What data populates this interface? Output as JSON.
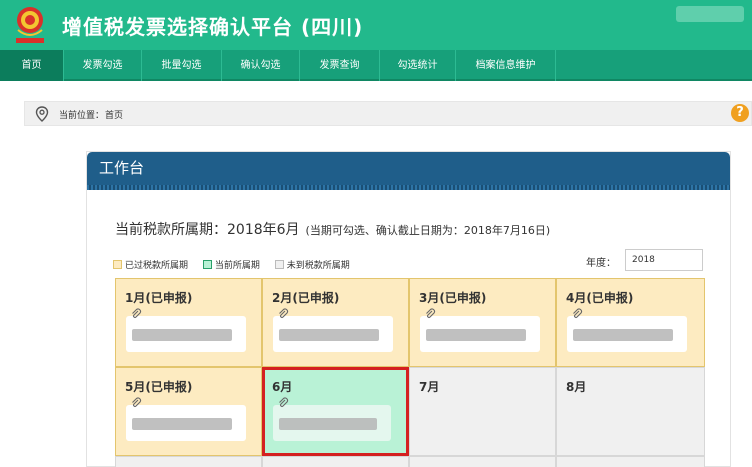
{
  "header": {
    "title": "增值税发票选择确认平台 (四川)",
    "logo": "national-tax-emblem"
  },
  "nav": {
    "items": [
      "首页",
      "发票勾选",
      "批量勾选",
      "确认勾选",
      "发票查询",
      "勾选统计",
      "档案信息维护"
    ],
    "active_index": 0
  },
  "breadcrumb": {
    "label": "当前位置：",
    "current": "首页"
  },
  "panel": {
    "title": "工作台"
  },
  "period": {
    "label": "当前税款所属期：",
    "value": "2018年6月",
    "note": "(当期可勾选、确认截止日期为：2018年7月16日)"
  },
  "legend": [
    {
      "label": "已过税款所属期",
      "color": "#fdebc1"
    },
    {
      "label": "当前所属期",
      "color": "#b9f2d6"
    },
    {
      "label": "未到税款所属期",
      "color": "#f0f0f0"
    }
  ],
  "year": {
    "label": "年度：",
    "value": "2018"
  },
  "calendar": {
    "months": [
      {
        "label": "1月(已申报)",
        "status": "filed"
      },
      {
        "label": "2月(已申报)",
        "status": "filed"
      },
      {
        "label": "3月(已申报)",
        "status": "filed"
      },
      {
        "label": "4月(已申报)",
        "status": "filed"
      },
      {
        "label": "5月(已申报)",
        "status": "filed"
      },
      {
        "label": "6月",
        "status": "current"
      },
      {
        "label": "7月",
        "status": "future"
      },
      {
        "label": "8月",
        "status": "future"
      }
    ]
  },
  "colors": {
    "header": "#22b98c",
    "nav": "#17a07a",
    "panel_head": "#1f5e8a",
    "current_border": "#d42020"
  }
}
